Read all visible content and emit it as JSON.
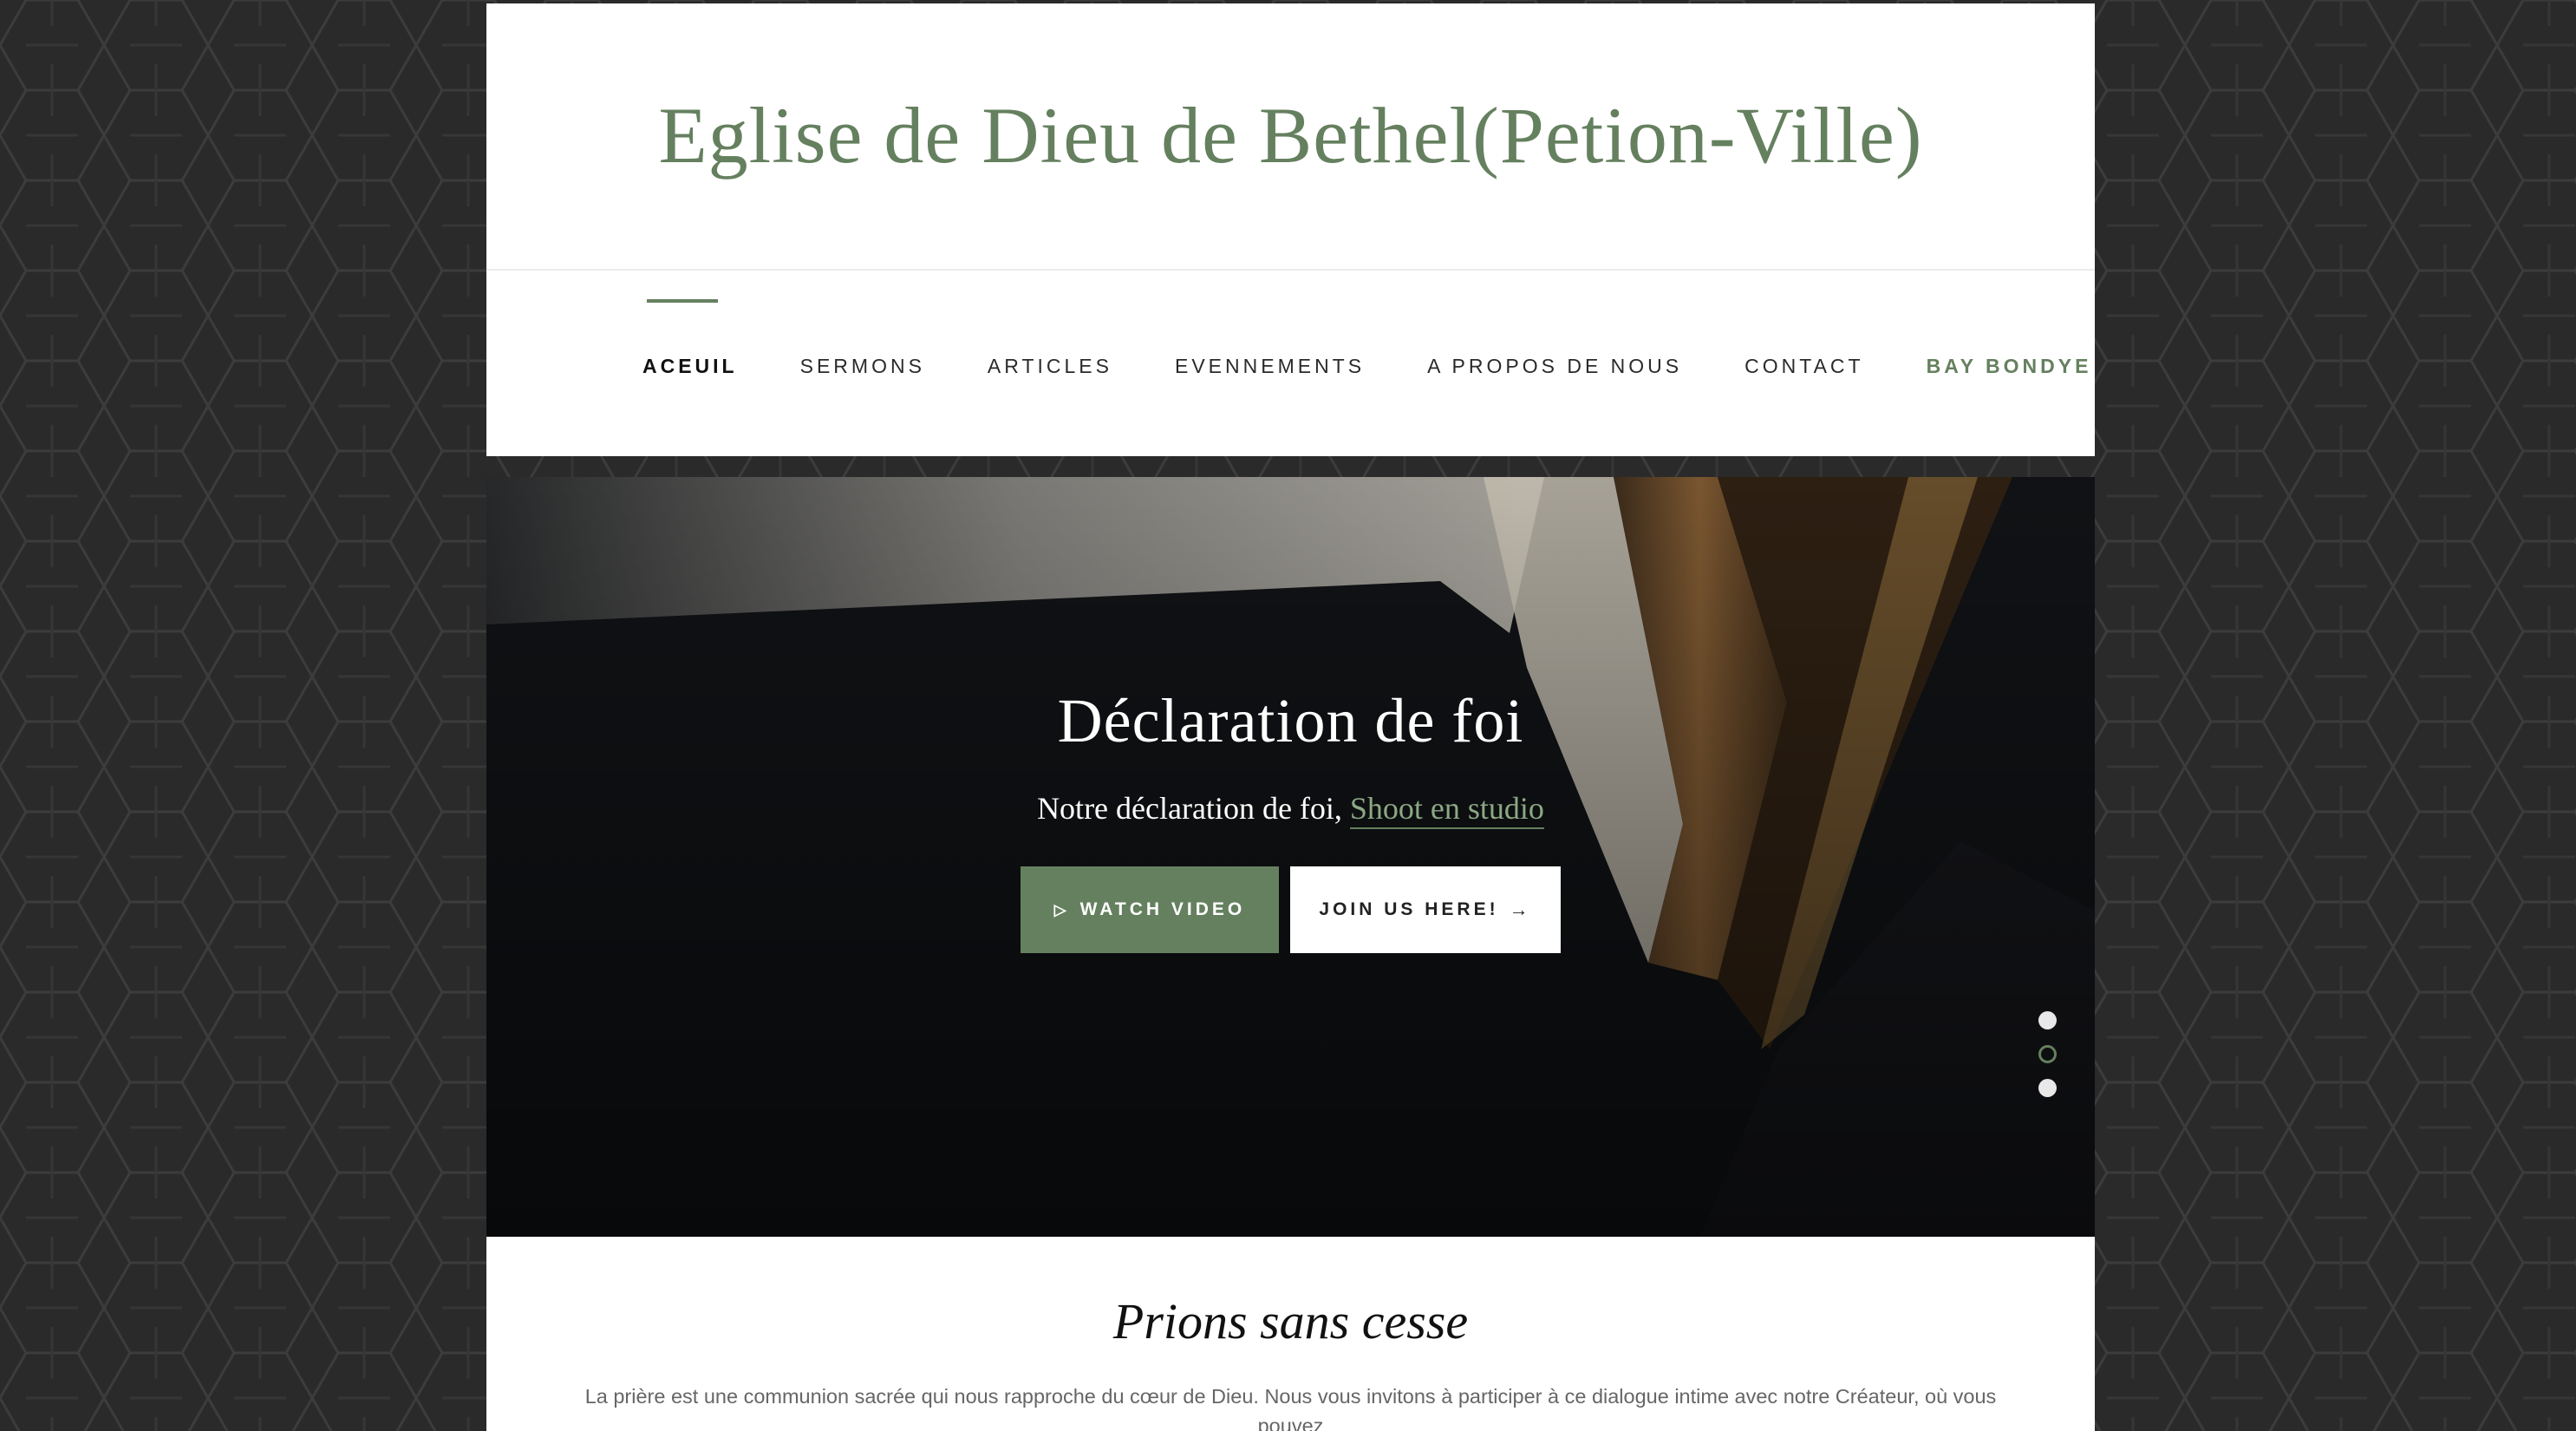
{
  "site": {
    "title": "Eglise de Dieu de Bethel(Petion-Ville)"
  },
  "nav": {
    "items": [
      {
        "label": "ACEUIL",
        "state": "active"
      },
      {
        "label": "SERMONS"
      },
      {
        "label": "ARTICLES"
      },
      {
        "label": "EVENNEMENTS"
      },
      {
        "label": "A PROPOS DE NOUS"
      },
      {
        "label": "CONTACT"
      },
      {
        "label": "BAY BONDYE",
        "state": "highlight"
      }
    ]
  },
  "hero": {
    "title": "Déclaration de foi",
    "subtitle_prefix": "Notre déclaration de foi,",
    "subtitle_link": "Shoot en studio",
    "watch_button": "WATCH VIDEO",
    "join_button": "JOIN US HERE!",
    "slider_dots": 3,
    "active_dot": 2
  },
  "section": {
    "title": "Prions sans cesse",
    "text": "La prière est une communion sacrée qui nous rapproche du cœur de Dieu. Nous vous invitons à participer à ce dialogue intime avec notre Créateur, où vous pouvez"
  },
  "colors": {
    "accent": "#65805f",
    "background": "#2a2a2a"
  },
  "icons": {
    "play": "play-icon",
    "arrow": "arrow-right-icon"
  }
}
